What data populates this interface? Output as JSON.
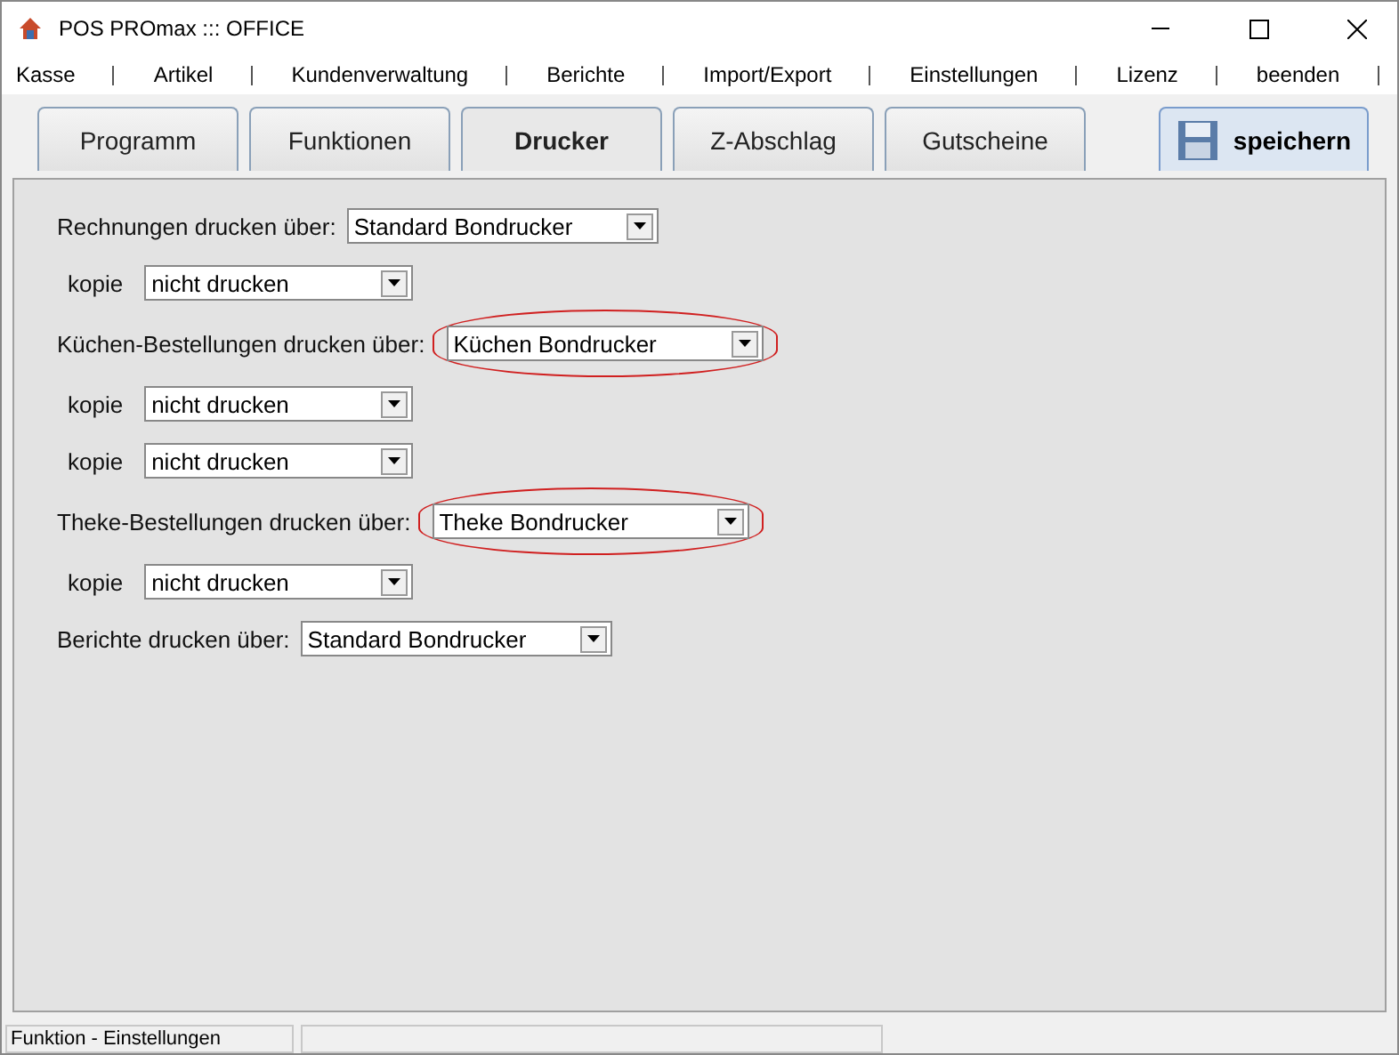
{
  "window": {
    "title": "POS PROmax ::: OFFICE"
  },
  "menu": [
    "Kasse",
    "Artikel",
    "Kundenverwaltung",
    "Berichte",
    "Import/Export",
    "Einstellungen",
    "Lizenz",
    "beenden"
  ],
  "tabs": [
    {
      "label": "Programm",
      "selected": false
    },
    {
      "label": "Funktionen",
      "selected": false
    },
    {
      "label": "Drucker",
      "selected": true
    },
    {
      "label": "Z-Abschlag",
      "selected": false
    },
    {
      "label": "Gutscheine",
      "selected": false
    }
  ],
  "save_button": "speichern",
  "settings": [
    {
      "kind": "printer",
      "label": "Rechnungen drucken über:",
      "value": "Standard Bondrucker",
      "highlighted": false
    },
    {
      "kind": "copy",
      "label": "kopie",
      "value": "nicht drucken",
      "highlighted": false
    },
    {
      "kind": "printer",
      "label": "Küchen-Bestellungen drucken über:",
      "value": "Küchen Bondrucker",
      "highlighted": true
    },
    {
      "kind": "copy",
      "label": "kopie",
      "value": "nicht drucken",
      "highlighted": false
    },
    {
      "kind": "copy",
      "label": "kopie",
      "value": "nicht drucken",
      "highlighted": false
    },
    {
      "kind": "printer",
      "label": "Theke-Bestellungen drucken über:",
      "value": "Theke Bondrucker",
      "highlighted": true
    },
    {
      "kind": "copy",
      "label": "kopie",
      "value": "nicht drucken",
      "highlighted": false
    },
    {
      "kind": "printer",
      "label": "Berichte drucken über:",
      "value": "Standard Bondrucker",
      "highlighted": false
    }
  ],
  "status_bar": "Funktion - Einstellungen"
}
